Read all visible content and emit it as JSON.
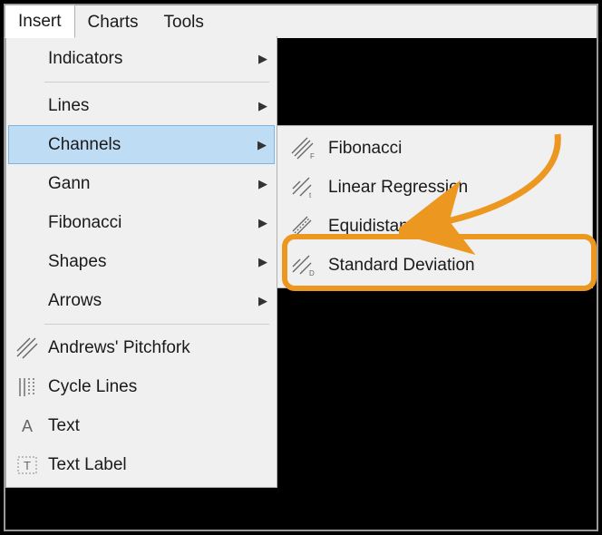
{
  "menubar": {
    "items": [
      {
        "label": "Insert",
        "open": true
      },
      {
        "label": "Charts",
        "open": false
      },
      {
        "label": "Tools",
        "open": false
      }
    ]
  },
  "menu": {
    "items": [
      {
        "label": "Indicators",
        "icon": "",
        "sub": true
      },
      {
        "sep": true
      },
      {
        "label": "Lines",
        "icon": "",
        "sub": true
      },
      {
        "label": "Channels",
        "icon": "",
        "sub": true,
        "selected": true
      },
      {
        "label": "Gann",
        "icon": "",
        "sub": true
      },
      {
        "label": "Fibonacci",
        "icon": "",
        "sub": true
      },
      {
        "label": "Shapes",
        "icon": "",
        "sub": true
      },
      {
        "label": "Arrows",
        "icon": "",
        "sub": true
      },
      {
        "sep": true
      },
      {
        "label": "Andrews' Pitchfork",
        "icon": "pitchfork"
      },
      {
        "label": "Cycle Lines",
        "icon": "cyclelines"
      },
      {
        "label": "Text",
        "icon": "text"
      },
      {
        "label": "Text Label",
        "icon": "textlabel"
      }
    ]
  },
  "submenu": {
    "items": [
      {
        "label": "Fibonacci",
        "icon": "channel-f"
      },
      {
        "label": "Linear Regression",
        "icon": "channel-lr"
      },
      {
        "label": "Equidistant",
        "icon": "channel-eq"
      },
      {
        "label": "Standard Deviation",
        "icon": "channel-sd",
        "highlighted": true
      }
    ]
  },
  "annotation": {
    "color": "#ec9720"
  }
}
